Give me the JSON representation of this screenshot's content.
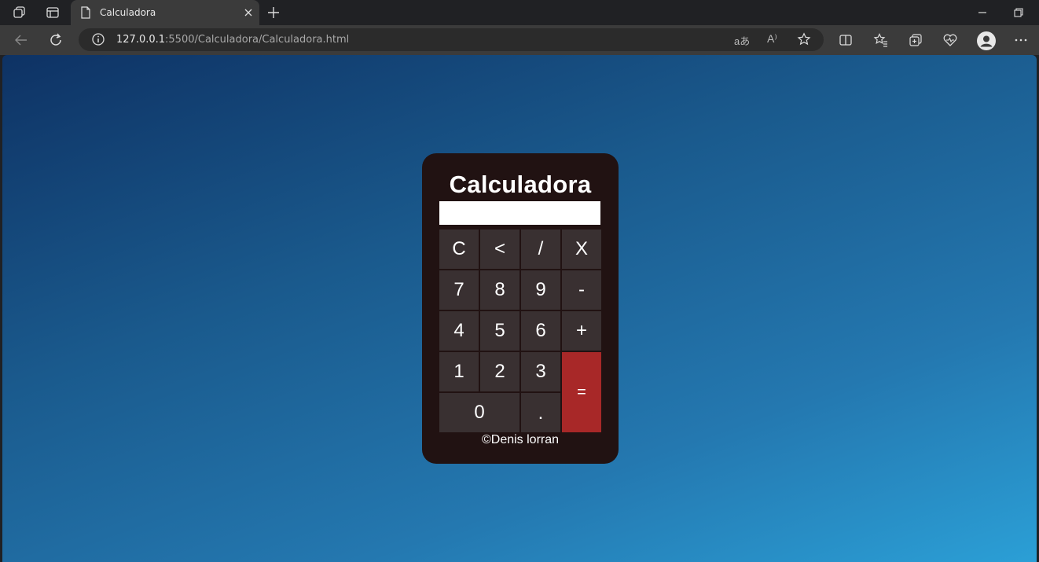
{
  "browser": {
    "tab_title": "Calculadora",
    "url_host": "127.0.0.1",
    "url_path": ":5500/Calculadora/Calculadora.html",
    "read_aloud_label": "A⁾",
    "translate_label": "aあ"
  },
  "calculator": {
    "title": "Calculadora",
    "display_value": "",
    "keys": {
      "clear": "C",
      "backspace": "<",
      "divide": "/",
      "multiply": "X",
      "seven": "7",
      "eight": "8",
      "nine": "9",
      "minus": "-",
      "four": "4",
      "five": "5",
      "six": "6",
      "plus": "+",
      "one": "1",
      "two": "2",
      "three": "3",
      "equals": "=",
      "zero": "0",
      "dot": "."
    },
    "footer": "©Denis lorran",
    "colors": {
      "panel": "#211212",
      "key": "#393031",
      "equals": "#a82828"
    }
  }
}
